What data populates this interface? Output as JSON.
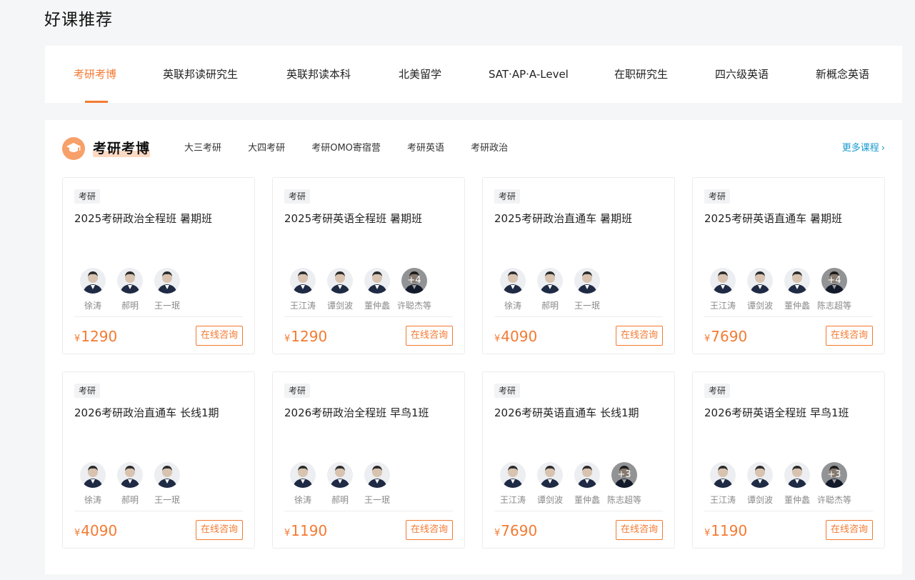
{
  "section": {
    "title": "好课推荐"
  },
  "top_tabs": [
    {
      "label": "考研考博",
      "active": true
    },
    {
      "label": "英联邦读研究生"
    },
    {
      "label": "英联邦读本科"
    },
    {
      "label": "北美留学"
    },
    {
      "label": "SAT·AP·A-Level"
    },
    {
      "label": "在职研究生"
    },
    {
      "label": "四六级英语"
    },
    {
      "label": "新概念英语"
    }
  ],
  "panel": {
    "category_title": "考研考博",
    "category_icon": "graduation-cap-icon",
    "subtabs": [
      "大三考研",
      "大四考研",
      "考研OMO寄宿营",
      "考研英语",
      "考研政治"
    ],
    "more_label": "更多课程",
    "more_icon": "chevron-right-icon"
  },
  "currency": "¥",
  "consult_label": "在线咨询",
  "accent_color": "#f47a32",
  "link_color": "#1a9bcf",
  "cards": [
    {
      "tag": "考研",
      "title": "2025考研政治全程班 暑期班",
      "price": "1290",
      "teachers": [
        {
          "name": "徐涛"
        },
        {
          "name": "郝明"
        },
        {
          "name": "王一珉"
        }
      ]
    },
    {
      "tag": "考研",
      "title": "2025考研英语全程班 暑期班",
      "price": "1290",
      "teachers": [
        {
          "name": "王江涛"
        },
        {
          "name": "谭剑波"
        },
        {
          "name": "董仲蠡"
        },
        {
          "name": "许聪杰等",
          "more": "+4"
        }
      ]
    },
    {
      "tag": "考研",
      "title": "2025考研政治直通车 暑期班",
      "price": "4090",
      "teachers": [
        {
          "name": "徐涛"
        },
        {
          "name": "郝明"
        },
        {
          "name": "王一珉"
        }
      ]
    },
    {
      "tag": "考研",
      "title": "2025考研英语直通车 暑期班",
      "price": "7690",
      "teachers": [
        {
          "name": "王江涛"
        },
        {
          "name": "谭剑波"
        },
        {
          "name": "董仲蠡"
        },
        {
          "name": "陈志超等",
          "more": "+4"
        }
      ]
    },
    {
      "tag": "考研",
      "title": "2026考研政治直通车 长线1期",
      "price": "4090",
      "teachers": [
        {
          "name": "徐涛"
        },
        {
          "name": "郝明"
        },
        {
          "name": "王一珉"
        }
      ]
    },
    {
      "tag": "考研",
      "title": "2026考研政治全程班 早鸟1班",
      "price": "1190",
      "teachers": [
        {
          "name": "徐涛"
        },
        {
          "name": "郝明"
        },
        {
          "name": "王一珉"
        }
      ]
    },
    {
      "tag": "考研",
      "title": "2026考研英语直通车 长线1期",
      "price": "7690",
      "teachers": [
        {
          "name": "王江涛"
        },
        {
          "name": "谭剑波"
        },
        {
          "name": "董仲蠡"
        },
        {
          "name": "陈志超等",
          "more": "+3"
        }
      ]
    },
    {
      "tag": "考研",
      "title": "2026考研英语全程班 早鸟1班",
      "price": "1190",
      "teachers": [
        {
          "name": "王江涛"
        },
        {
          "name": "谭剑波"
        },
        {
          "name": "董仲蠡"
        },
        {
          "name": "许聪杰等",
          "more": "+3"
        }
      ]
    }
  ]
}
